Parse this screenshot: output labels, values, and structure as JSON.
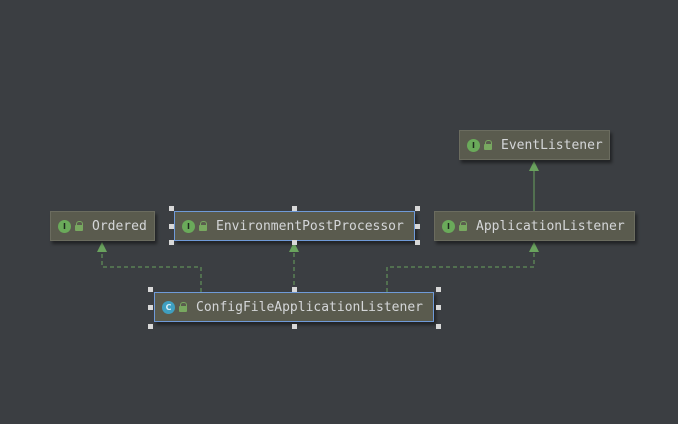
{
  "diagram": {
    "nodes": [
      {
        "id": "event_listener",
        "kind": "interface",
        "badge": "I",
        "name": "EventListener"
      },
      {
        "id": "ordered",
        "kind": "interface",
        "badge": "I",
        "name": "Ordered"
      },
      {
        "id": "env_post_processor",
        "kind": "interface",
        "badge": "I",
        "name": "EnvironmentPostProcessor"
      },
      {
        "id": "application_listener",
        "kind": "interface",
        "badge": "I",
        "name": "ApplicationListener"
      },
      {
        "id": "config_file_listener",
        "kind": "class",
        "badge": "C",
        "name": "ConfigFileApplicationListener"
      }
    ],
    "edges": [
      {
        "from": "application_listener",
        "to": "event_listener",
        "type": "extends",
        "style": "solid"
      },
      {
        "from": "config_file_listener",
        "to": "ordered",
        "type": "implements",
        "style": "dashed"
      },
      {
        "from": "config_file_listener",
        "to": "env_post_processor",
        "type": "implements",
        "style": "dashed"
      },
      {
        "from": "config_file_listener",
        "to": "application_listener",
        "type": "implements",
        "style": "dashed"
      }
    ]
  },
  "colors": {
    "background": "#3b3e42",
    "node_fill": "#5a5b4e",
    "edge": "#6aa35e",
    "selection": "#6f9ad8",
    "interface_badge": "#6aaa5a",
    "class_badge": "#3f9fc0"
  }
}
